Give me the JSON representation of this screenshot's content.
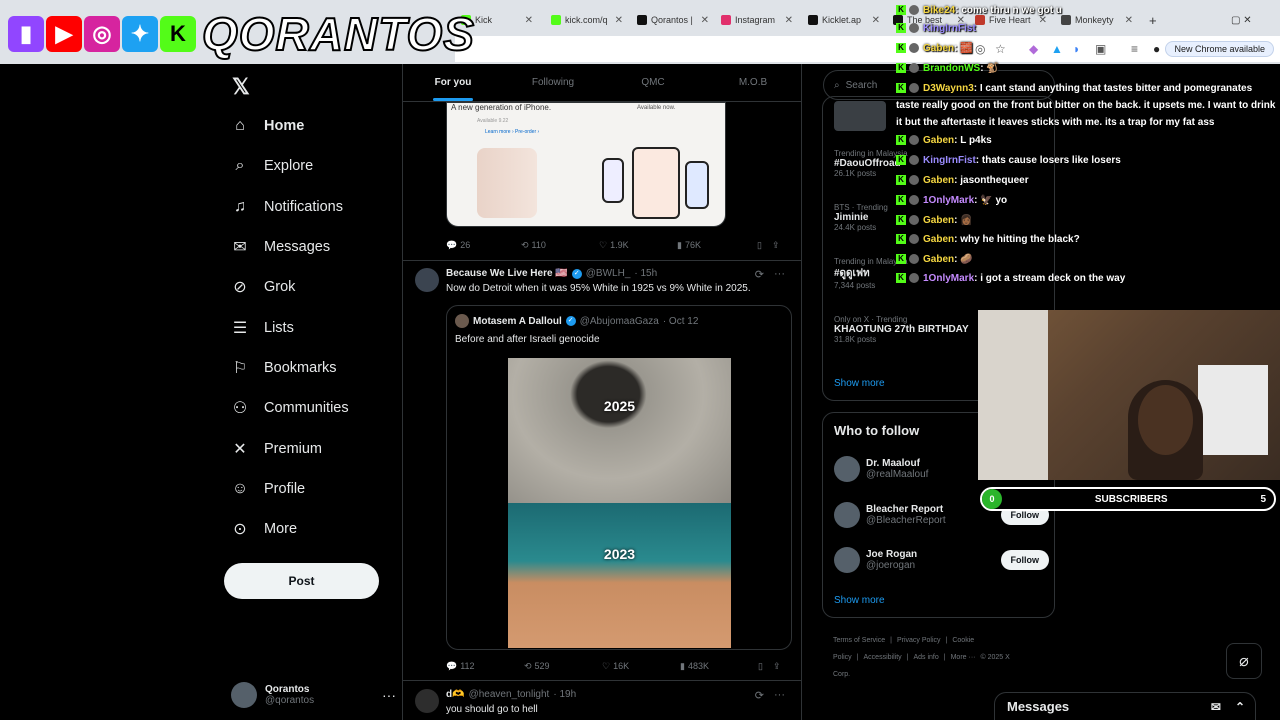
{
  "brand": {
    "name": "QORANTOS"
  },
  "browser": {
    "tabs": [
      {
        "label": "Kick",
        "color": "#53fc18"
      },
      {
        "label": "kick.com/q",
        "color": "#53fc18"
      },
      {
        "label": "Qorantos |",
        "color": "#111111"
      },
      {
        "label": "Instagram",
        "color": "#e1306c"
      },
      {
        "label": "Kicklet.ap",
        "color": "#111111"
      },
      {
        "label": "The best",
        "color": "#111111"
      },
      {
        "label": "Five Heart",
        "color": "#c0392b"
      },
      {
        "label": "Monkeyty",
        "color": "#444444"
      }
    ],
    "new_chrome": "New Chrome available"
  },
  "nav": {
    "items": [
      {
        "label": "Home",
        "icon": "home-icon"
      },
      {
        "label": "Explore",
        "icon": "search-icon"
      },
      {
        "label": "Notifications",
        "icon": "bell-icon"
      },
      {
        "label": "Messages",
        "icon": "mail-icon"
      },
      {
        "label": "Grok",
        "icon": "grok-icon"
      },
      {
        "label": "Lists",
        "icon": "list-icon"
      },
      {
        "label": "Bookmarks",
        "icon": "bookmark-icon"
      },
      {
        "label": "Communities",
        "icon": "communities-icon"
      },
      {
        "label": "Premium",
        "icon": "x-icon"
      },
      {
        "label": "Profile",
        "icon": "profile-icon"
      },
      {
        "label": "More",
        "icon": "more-icon"
      }
    ],
    "post_label": "Post",
    "account": {
      "name": "Qorantos",
      "handle": "@qorantos"
    }
  },
  "feed": {
    "tabs": [
      "For you",
      "Following",
      "QMC",
      "M.O.B"
    ],
    "media1": {
      "title": "A new generation of iPhone.",
      "sub": "Available 9.22",
      "links": "Learn more ›   Pre-order ›",
      "right": "Available now."
    },
    "actions1": {
      "reply": "26",
      "repost": "110",
      "like": "1.9K",
      "views": "76K"
    },
    "tweet2": {
      "name": "Because We Live Here 🇺🇸",
      "handle": "@BWLH_",
      "time": "· 15h",
      "text": "Now do Detroit when it was 95% White in 1925 vs 9% White in 2025.",
      "quote": {
        "name": "Motasem A Dalloul",
        "handle": "@AbujomaaGaza",
        "time": "· Oct 12",
        "text": "Before and after Israeli genocide",
        "year_top": "2025",
        "year_bottom": "2023"
      },
      "actions": {
        "reply": "112",
        "repost": "529",
        "like": "16K",
        "views": "483K"
      }
    },
    "tweet3": {
      "name": "d🫶",
      "handle": "@heaven_tonlight",
      "time": "· 19h",
      "text": "you should go to hell"
    }
  },
  "right": {
    "search_placeholder": "Search",
    "trends": [
      {
        "ctx": "",
        "topic": "",
        "count": ""
      },
      {
        "ctx": "Trending in Malaysia",
        "topic": "#DaouOffroad",
        "count": "26.1K posts"
      },
      {
        "ctx": "BTS · Trending",
        "topic": "Jiminie",
        "count": "24.4K posts"
      },
      {
        "ctx": "Trending in Malaysia",
        "topic": "#ดูดูเฟท",
        "count": "7,344 posts"
      },
      {
        "ctx": "Only on X · Trending",
        "topic": "KHAOTUNG 27th BIRTHDAY",
        "count": "31.8K posts"
      }
    ],
    "show_more": "Show more",
    "who_to_follow": {
      "title": "Who to follow",
      "people": [
        {
          "name": "Dr. Maalouf",
          "handle": "@realMaalouf",
          "btn": "Follow"
        },
        {
          "name": "Bleacher Report",
          "handle": "@BleacherReport",
          "btn": "Follow"
        },
        {
          "name": "Joe Rogan",
          "handle": "@joerogan",
          "btn": "Follow"
        }
      ],
      "show_more": "Show more"
    },
    "footer": [
      "Terms of Service",
      "|",
      "Privacy Policy",
      "|",
      "Cookie Policy",
      "|",
      "Accessibility",
      "|",
      "Ads info",
      "|",
      "More ···",
      "© 2025 X Corp."
    ]
  },
  "chat": [
    {
      "user": "Bike24",
      "color": "#f5d742",
      "msg": ": come thru n we got u"
    },
    {
      "user": "KingIrnFist",
      "color": "#9b8cff",
      "msg": ""
    },
    {
      "user": "Gaben",
      "color": "#f5d742",
      "msg": ": 🧱"
    },
    {
      "user": "BrandonWS",
      "color": "#53fc18",
      "msg": ": 🐒"
    },
    {
      "user": "D3Waynn3",
      "color": "#f5d742",
      "msg": ": I cant stand anything that tastes bitter and pomegranates taste really good on the front but bitter on the back. it upsets me. I want to drink it but the aftertaste it leaves sticks with me. its a trap for my fat ass"
    },
    {
      "user": "Gaben",
      "color": "#f5d742",
      "msg": ": L p4ks"
    },
    {
      "user": "KingIrnFist",
      "color": "#9b8cff",
      "msg": ": thats cause losers like losers"
    },
    {
      "user": "Gaben",
      "color": "#f5d742",
      "msg": ": jasonthequeer"
    },
    {
      "user": "1OnlyMark",
      "color": "#c58bff",
      "msg": ": 🦅 yo"
    },
    {
      "user": "Gaben",
      "color": "#f5d742",
      "msg": ": 👩🏾"
    },
    {
      "user": "Gaben",
      "color": "#f5d742",
      "msg": ": why he hitting the black?"
    },
    {
      "user": "Gaben",
      "color": "#f5d742",
      "msg": ": 🥔"
    },
    {
      "user": "1OnlyMark",
      "color": "#c58bff",
      "msg": ": i got a stream deck on the way"
    }
  ],
  "subs": {
    "level": "0",
    "label": "SUBSCRIBERS",
    "count": "5"
  },
  "messages_dock": {
    "title": "Messages"
  }
}
